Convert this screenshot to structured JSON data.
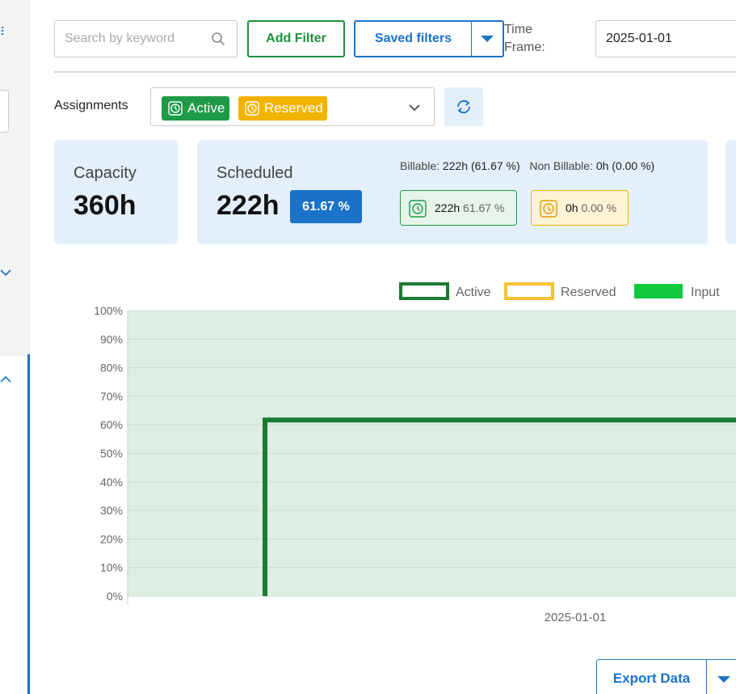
{
  "toolbar": {
    "search_placeholder": "Search by keyword",
    "add_filter_label": "Add Filter",
    "saved_filters_label": "Saved filters",
    "time_frame_label": "Time Frame:",
    "time_frame_value": "2025-01-01"
  },
  "assignments": {
    "label": "Assignments",
    "selected_tags": [
      {
        "label": "Active",
        "color": "#1f9a47",
        "icon": "clock-icon"
      },
      {
        "label": "Reserved",
        "color": "#f2b300",
        "icon": "clock-icon"
      }
    ],
    "refresh_icon": "refresh-icon"
  },
  "stats": {
    "capacity": {
      "label": "Capacity",
      "value": "360h"
    },
    "scheduled": {
      "label": "Scheduled",
      "value": "222h",
      "percent": "61.67 %",
      "billable_label": "Billable:",
      "billable_value": "222h (61.67 %)",
      "non_billable_label": "Non Billable:",
      "non_billable_value": "0h (0.00 %)",
      "active_hours": "222h",
      "active_percent": "61.67 %",
      "reserved_hours": "0h",
      "reserved_percent": "0.00 %"
    }
  },
  "chart_data": {
    "type": "line",
    "legend": [
      {
        "name": "Active",
        "style": "outline",
        "color": "#1b7a33"
      },
      {
        "name": "Reserved",
        "style": "outline",
        "color": "#f7c134"
      },
      {
        "name": "Input",
        "style": "fill",
        "color": "#11c93f"
      }
    ],
    "legend_position": "top-right",
    "y_ticks": [
      "100%",
      "90%",
      "80%",
      "70%",
      "60%",
      "50%",
      "40%",
      "30%",
      "20%",
      "10%",
      "0%"
    ],
    "ylim": [
      0,
      100
    ],
    "x_tick_labels": [
      "2025-01-01"
    ],
    "series": [
      {
        "name": "Active",
        "values": [
          61.67
        ],
        "color": "#1b7a33"
      },
      {
        "name": "Reserved",
        "values": [
          0
        ],
        "color": "#f7c134"
      },
      {
        "name": "Input",
        "values": [
          100
        ],
        "color": "#dcefe2"
      }
    ],
    "grid": true
  },
  "export": {
    "label": "Export Data"
  },
  "colors": {
    "accent": "#1a73c8",
    "active": "#1f9a47",
    "reserved": "#f2b300"
  }
}
